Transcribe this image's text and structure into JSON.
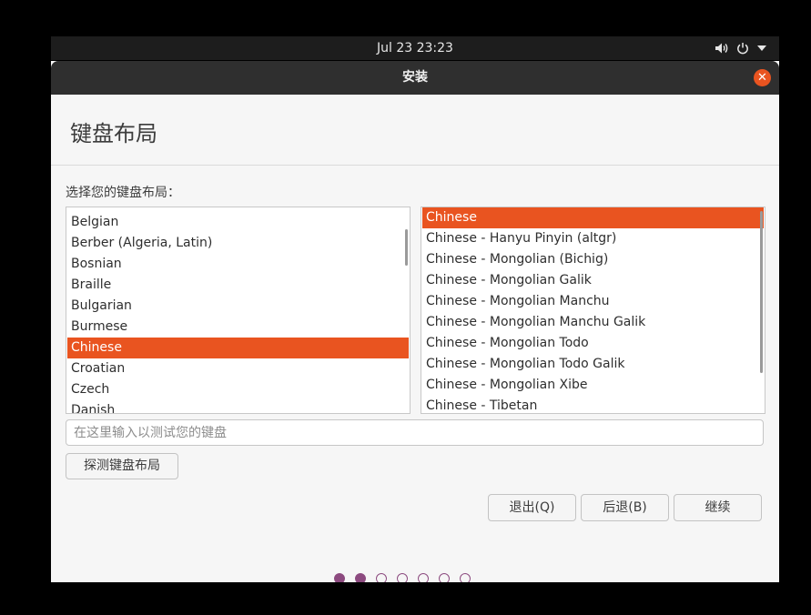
{
  "top_bar": {
    "datetime": "Jul 23  23:23",
    "icons": [
      "volume-icon",
      "power-icon",
      "menu-arrow-icon"
    ]
  },
  "window": {
    "title": "安装",
    "close_icon": "close-icon"
  },
  "page": {
    "heading": "键盘布局",
    "prompt": "选择您的键盘布局："
  },
  "layouts": {
    "items": [
      "Belgian",
      "Berber (Algeria, Latin)",
      "Bosnian",
      "Braille",
      "Bulgarian",
      "Burmese",
      "Chinese",
      "Croatian",
      "Czech",
      "Danish"
    ],
    "selected": "Chinese"
  },
  "variants": {
    "items": [
      "Chinese",
      "Chinese - Hanyu Pinyin (altgr)",
      "Chinese - Mongolian (Bichig)",
      "Chinese - Mongolian Galik",
      "Chinese - Mongolian Manchu",
      "Chinese - Mongolian Manchu Galik",
      "Chinese - Mongolian Todo",
      "Chinese - Mongolian Todo Galik",
      "Chinese - Mongolian Xibe",
      "Chinese - Tibetan"
    ],
    "selected": "Chinese"
  },
  "test_field": {
    "placeholder": "在这里输入以测试您的键盘",
    "value": ""
  },
  "buttons": {
    "detect": "探测键盘布局",
    "quit": "退出(Q)",
    "back": "后退(B)",
    "continue": "继续"
  },
  "progress": {
    "total_steps": 7,
    "completed_steps": 2
  },
  "colors": {
    "accent": "#e95420",
    "progress": "#8c4a7f",
    "titlebar": "#2f2f2f"
  }
}
